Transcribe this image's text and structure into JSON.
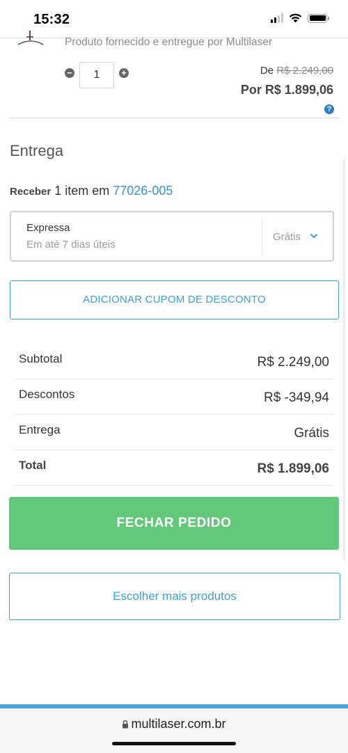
{
  "status_bar": {
    "time": "15:32"
  },
  "product": {
    "provider_text": "Produto fornecido e entregue por Multilaser",
    "quantity": "1",
    "price_from_label": "De",
    "price_from": "R$ 2.249,00",
    "price_now": "Por R$ 1.899,06"
  },
  "delivery": {
    "title": "Entrega",
    "receive_label": "Receber",
    "receive_text": "1 item em",
    "zipcode": "77026-005",
    "shipping": {
      "name": "Expressa",
      "eta": "Em até 7 dias úteis",
      "price": "Grátis"
    }
  },
  "coupon_button": "ADICIONAR CUPOM DE DESCONTO",
  "summary": {
    "rows": [
      {
        "label": "Subtotal",
        "value": "R$ 2.249,00"
      },
      {
        "label": "Descontos",
        "value": "R$ -349,94"
      },
      {
        "label": "Entrega",
        "value": "Grátis"
      },
      {
        "label": "Total",
        "value": "R$ 1.899,06"
      }
    ]
  },
  "checkout_button": "FECHAR PEDIDO",
  "more_products_button": "Escolher mais produtos",
  "browser": {
    "url": "multilaser.com.br"
  },
  "colors": {
    "accent": "#3aa0d6",
    "checkout": "#63c879",
    "zipcode_link": "#3a8fd0"
  }
}
